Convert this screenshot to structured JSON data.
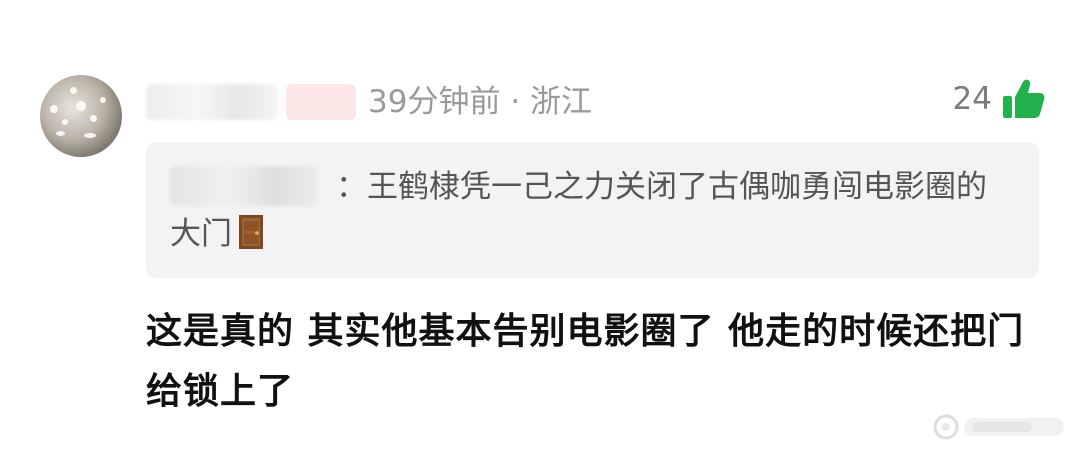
{
  "comment": {
    "username": "",
    "user_tag": "",
    "time": "39分钟前",
    "separator": "·",
    "location": "浙江",
    "likes": "24",
    "icons": {
      "avatar": "avatar-image",
      "like": "thumbs-up-icon",
      "door": "door-emoji"
    },
    "quote": {
      "author": "",
      "colon": "：",
      "text": "王鹤棣凭一己之力关闭了古偶咖勇闯电影圈的大门"
    },
    "body": "这是真的 其实他基本告别电影圈了 他走的时候还把门给锁上了"
  },
  "colors": {
    "like_green": "#22b14c",
    "meta_gray": "#9a9a9a",
    "quote_bg": "#f3f3f3",
    "body_text": "#111111"
  },
  "watermark": {
    "icon": "weibo-watermark"
  }
}
